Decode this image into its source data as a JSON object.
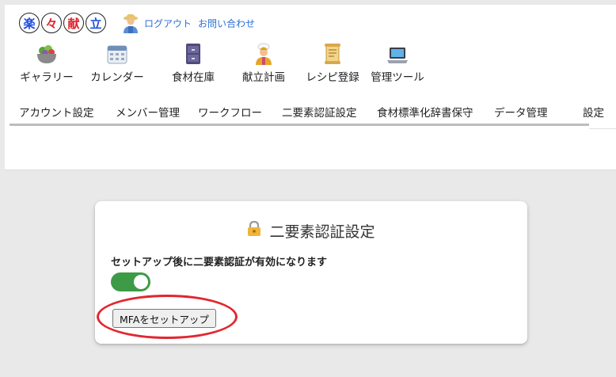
{
  "logo": {
    "chars": [
      "楽",
      "々",
      "献",
      "立"
    ],
    "colors": [
      "#1f4fe0",
      "#e0202a",
      "#e0202a",
      "#1f4fe0"
    ]
  },
  "header": {
    "logout_label": "ログアウト",
    "contact_label": "お問い合わせ"
  },
  "icon_menu": [
    {
      "label": "ギャラリー",
      "icon": "salad-bowl-icon"
    },
    {
      "label": "カレンダー",
      "icon": "calendar-icon"
    },
    {
      "label": "食材在庫",
      "icon": "cabinet-icon"
    },
    {
      "label": "献立計画",
      "icon": "chef-icon"
    },
    {
      "label": "レシピ登録",
      "icon": "scroll-icon"
    },
    {
      "label": "管理ツール",
      "icon": "laptop-icon"
    }
  ],
  "tabs": [
    {
      "label": "アカウント設定"
    },
    {
      "label": "メンバー管理"
    },
    {
      "label": "ワークフロー"
    },
    {
      "label": "二要素認証設定"
    },
    {
      "label": "食材標準化辞書保守"
    },
    {
      "label": "データ管理"
    },
    {
      "label": "設定"
    }
  ],
  "card": {
    "title": "二要素認証設定",
    "title_icon": "lock-icon",
    "description": "セットアップ後に二要素認証が有効になります",
    "toggle_on": true,
    "toggle_color": "#3d9b47",
    "button_label": "MFAをセットアップ"
  },
  "annotation_color": "#e3262f"
}
